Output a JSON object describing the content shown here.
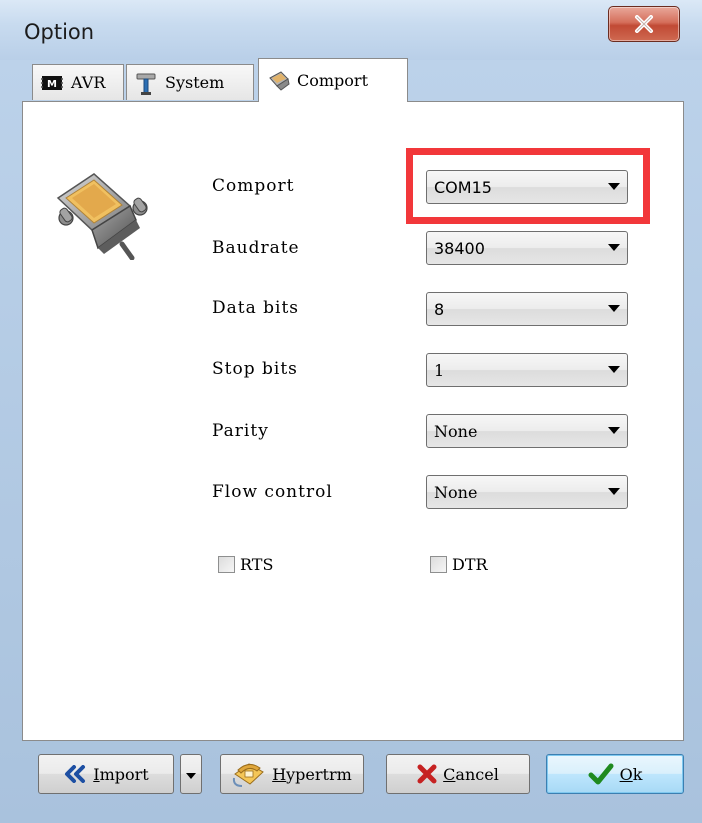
{
  "window": {
    "title": "Option"
  },
  "tabs": [
    {
      "label": "AVR",
      "icon": "chip-icon",
      "active": false
    },
    {
      "label": "System",
      "icon": "tools-icon",
      "active": false
    },
    {
      "label": "Comport",
      "icon": "serial-connector-icon",
      "active": true
    }
  ],
  "form": {
    "comport": {
      "label": "Comport",
      "value": "COM15"
    },
    "baudrate": {
      "label": "Baudrate",
      "value": "38400"
    },
    "data_bits": {
      "label": "Data bits",
      "value": "8"
    },
    "stop_bits": {
      "label": "Stop bits",
      "value": "1"
    },
    "parity": {
      "label": "Parity",
      "value": "None"
    },
    "flow_control": {
      "label": "Flow control",
      "value": "None"
    }
  },
  "checkboxes": {
    "rts": {
      "label": "RTS",
      "checked": false
    },
    "dtr": {
      "label": "DTR",
      "checked": false
    }
  },
  "footer": {
    "import_prefix": "I",
    "import_rest": "mport",
    "hypertrm_prefix": "H",
    "hypertrm_rest": "ypertrm",
    "cancel_prefix": "C",
    "cancel_rest": "ancel",
    "ok_prefix": "O",
    "ok_rest": "k"
  },
  "colors": {
    "highlight": "#f2373a",
    "close_button": "#c14a34",
    "ok_button": "#bee6fd"
  }
}
